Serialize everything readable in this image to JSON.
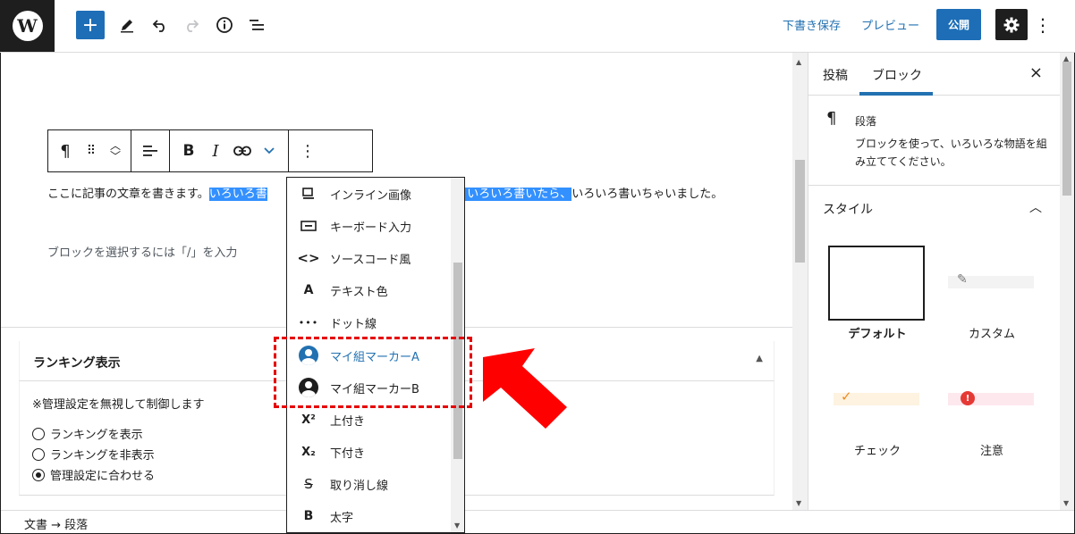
{
  "topbar": {
    "logo": "W",
    "add_icon": "+",
    "draft_label": "下書き保存",
    "preview_label": "プレビュー",
    "publish_label": "公開"
  },
  "block_toolbar": {
    "paragraph_icon": "¶",
    "drag_icon": "⠿",
    "align_icon": "≡",
    "bold_label": "B",
    "italic_label": "I",
    "link_icon": "⛓",
    "more_chevron": "⌄",
    "options_icon": "⋮"
  },
  "editor": {
    "paragraph_before": "ここに記事の文章を書きます。",
    "paragraph_selected_1": "いろいろ書",
    "paragraph_selected_2": "と、いろいろ書いたら、",
    "paragraph_after": "いろいろ書いちゃいました。",
    "placeholder": "ブロックを選択するには「/」を入力"
  },
  "metabox": {
    "title": "ランキング表示",
    "note": "※管理設定を無視して制御します",
    "options": [
      {
        "label": "ランキングを表示",
        "checked": false
      },
      {
        "label": "ランキングを非表示",
        "checked": false
      },
      {
        "label": "管理設定に合わせる",
        "checked": true
      }
    ]
  },
  "footer": {
    "breadcrumb": "文書 → 段落"
  },
  "sidebar": {
    "tab_post": "投稿",
    "tab_block": "ブロック",
    "close_icon": "×",
    "block_icon": "¶",
    "block_name": "段落",
    "block_desc": "ブロックを使って、いろいろな物語を組み立ててください。",
    "styles_heading": "スタイル",
    "styles": [
      {
        "label": "デフォルト",
        "selected": true
      },
      {
        "label": "カスタム",
        "selected": false
      },
      {
        "label": "チェック",
        "selected": false
      },
      {
        "label": "注意",
        "selected": false
      }
    ]
  },
  "dropdown": {
    "items": [
      {
        "label": "インライン画像",
        "icon": "image-icon",
        "glyph": "▭"
      },
      {
        "label": "キーボード入力",
        "icon": "keyboard-icon",
        "glyph": "▭"
      },
      {
        "label": "ソースコード風",
        "icon": "code-icon",
        "glyph": "<>"
      },
      {
        "label": "テキスト色",
        "icon": "text-color-icon",
        "glyph": "A"
      },
      {
        "label": "ドット線",
        "icon": "dots-icon",
        "glyph": "•••"
      },
      {
        "label": "マイ組マーカーA",
        "icon": "user-avatar-icon",
        "glyph": ""
      },
      {
        "label": "マイ組マーカーB",
        "icon": "user-avatar-icon",
        "glyph": ""
      },
      {
        "label": "上付き",
        "icon": "superscript-icon",
        "glyph": "X²"
      },
      {
        "label": "下付き",
        "icon": "subscript-icon",
        "glyph": "X₂"
      },
      {
        "label": "取り消し線",
        "icon": "strikethrough-icon",
        "glyph": "S"
      },
      {
        "label": "太字",
        "icon": "bold-icon",
        "glyph": "B"
      }
    ]
  },
  "colors": {
    "accent": "#2271b1",
    "annotation": "#e60000",
    "selection": "#3390ff"
  }
}
